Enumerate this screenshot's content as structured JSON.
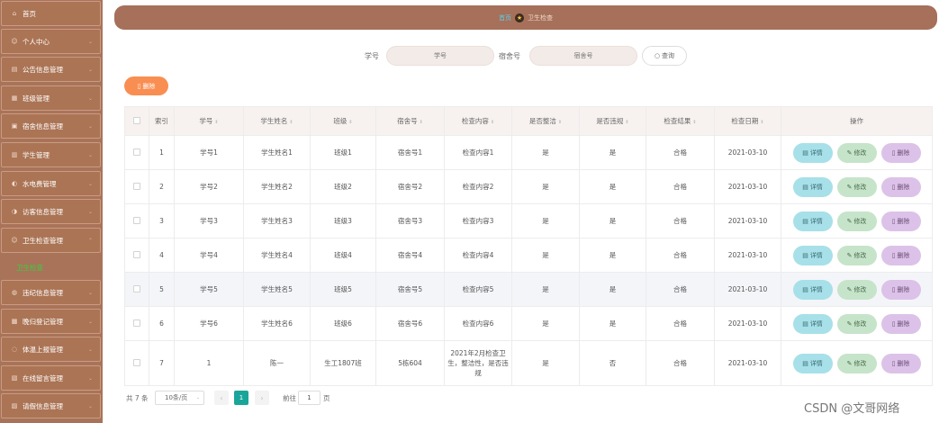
{
  "sidebar": {
    "items": [
      {
        "label": "首页",
        "icon": "⌂"
      },
      {
        "label": "个人中心",
        "icon": "☺"
      },
      {
        "label": "公告信息管理",
        "icon": "▤"
      },
      {
        "label": "班级管理",
        "icon": "▦"
      },
      {
        "label": "宿舍信息管理",
        "icon": "▣"
      },
      {
        "label": "学生管理",
        "icon": "▥"
      },
      {
        "label": "水电费管理",
        "icon": "◐"
      },
      {
        "label": "访客信息管理",
        "icon": "◑"
      },
      {
        "label": "卫生检查管理",
        "icon": "☺"
      },
      {
        "label": "违纪信息管理",
        "icon": "◍"
      },
      {
        "label": "晚归登记管理",
        "icon": "▩"
      },
      {
        "label": "体温上报管理",
        "icon": "◌"
      },
      {
        "label": "在线留言管理",
        "icon": "▧"
      },
      {
        "label": "请假信息管理",
        "icon": "▨"
      }
    ],
    "active_sub": "卫生检查"
  },
  "breadcrumb": {
    "home": "首页",
    "current": "卫生检查",
    "separator_icon": "★"
  },
  "search": {
    "student_id_label": "学号",
    "student_id_placeholder": "学号",
    "dorm_label": "宿舍号",
    "dorm_placeholder": "宿舍号",
    "button_label": "查询",
    "button_icon": "○"
  },
  "toolbar": {
    "delete_label": "删除",
    "delete_icon": "▯"
  },
  "table": {
    "sort_icon": "⇕",
    "headers": [
      "索引",
      "学号",
      "学生姓名",
      "班级",
      "宿舍号",
      "检查内容",
      "是否整洁",
      "是否违规",
      "检查结果",
      "检查日期",
      "操作"
    ],
    "rows": [
      {
        "index": "1",
        "student_id": "学号1",
        "name": "学生姓名1",
        "class": "班级1",
        "dorm": "宿舍号1",
        "content": "检查内容1",
        "tidy": "是",
        "violation": "是",
        "result": "合格",
        "date": "2021-03-10"
      },
      {
        "index": "2",
        "student_id": "学号2",
        "name": "学生姓名2",
        "class": "班级2",
        "dorm": "宿舍号2",
        "content": "检查内容2",
        "tidy": "是",
        "violation": "是",
        "result": "合格",
        "date": "2021-03-10"
      },
      {
        "index": "3",
        "student_id": "学号3",
        "name": "学生姓名3",
        "class": "班级3",
        "dorm": "宿舍号3",
        "content": "检查内容3",
        "tidy": "是",
        "violation": "是",
        "result": "合格",
        "date": "2021-03-10"
      },
      {
        "index": "4",
        "student_id": "学号4",
        "name": "学生姓名4",
        "class": "班级4",
        "dorm": "宿舍号4",
        "content": "检查内容4",
        "tidy": "是",
        "violation": "是",
        "result": "合格",
        "date": "2021-03-10"
      },
      {
        "index": "5",
        "student_id": "学号5",
        "name": "学生姓名5",
        "class": "班级5",
        "dorm": "宿舍号5",
        "content": "检查内容5",
        "tidy": "是",
        "violation": "是",
        "result": "合格",
        "date": "2021-03-10"
      },
      {
        "index": "6",
        "student_id": "学号6",
        "name": "学生姓名6",
        "class": "班级6",
        "dorm": "宿舍号6",
        "content": "检查内容6",
        "tidy": "是",
        "violation": "是",
        "result": "合格",
        "date": "2021-03-10"
      },
      {
        "index": "7",
        "student_id": "1",
        "name": "陈一",
        "class": "生工1807班",
        "dorm": "5栋604",
        "content": "2021年2月检查卫生，整洁性，是否违规",
        "tidy": "是",
        "violation": "否",
        "result": "合格",
        "date": "2021-03-10"
      }
    ],
    "actions": {
      "detail": "详情",
      "edit": "修改",
      "delete": "删除"
    },
    "action_icons": {
      "detail": "▤",
      "edit": "✎",
      "delete": "▯"
    }
  },
  "pagination": {
    "total": "共 7 条",
    "page_size": "10条/页",
    "prev": "‹",
    "next": "›",
    "current_page": "1",
    "goto_label": "前往",
    "goto_value": "1",
    "page_suffix": "页"
  },
  "watermark": "CSDN @文哥网络"
}
